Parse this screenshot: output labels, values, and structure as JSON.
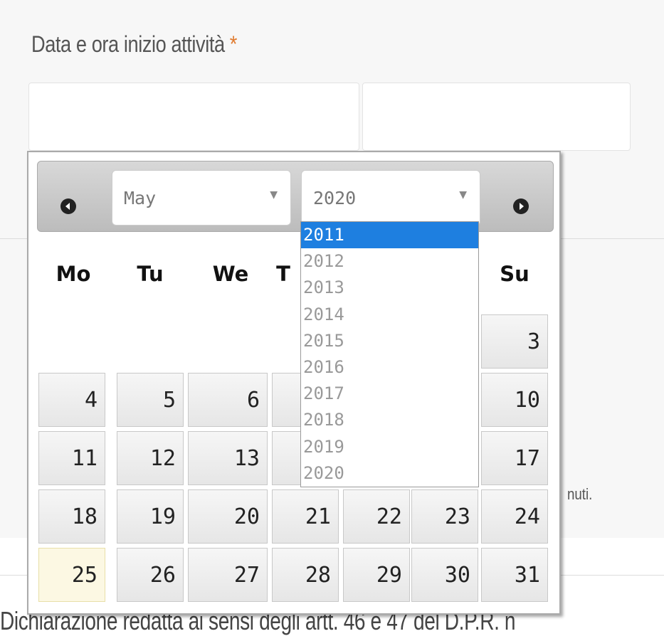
{
  "form": {
    "label": "Data e ora inizio attività",
    "required_mark": "*",
    "footnote_fragment": "nuti.",
    "declaration": "Dichiarazione redatta ai sensi degli artt. 46 e 47 del D.P.R. n"
  },
  "datepicker": {
    "prev_icon": "arrow-left-circle-icon",
    "next_icon": "arrow-right-circle-icon",
    "month_select": {
      "value": "May"
    },
    "year_select": {
      "value": "2020"
    },
    "weekdays": [
      "Mo",
      "Tu",
      "We",
      "T",
      "Su"
    ],
    "days": [
      [
        "",
        "",
        "",
        "",
        "",
        "",
        "3"
      ],
      [
        "4",
        "5",
        "6",
        "",
        "",
        "",
        "10"
      ],
      [
        "11",
        "12",
        "13",
        "",
        "",
        "",
        "17"
      ],
      [
        "18",
        "19",
        "20",
        "21",
        "22",
        "23",
        "24"
      ],
      [
        "25",
        "26",
        "27",
        "28",
        "29",
        "30",
        "31"
      ]
    ],
    "today": "25",
    "year_options": [
      "2011",
      "2012",
      "2013",
      "2014",
      "2015",
      "2016",
      "2017",
      "2018",
      "2019",
      "2020"
    ],
    "year_highlighted": "2011",
    "colors": {
      "highlight": "#1e7fe0",
      "today_bg": "#fcf8e3",
      "required": "#e07b30"
    }
  }
}
